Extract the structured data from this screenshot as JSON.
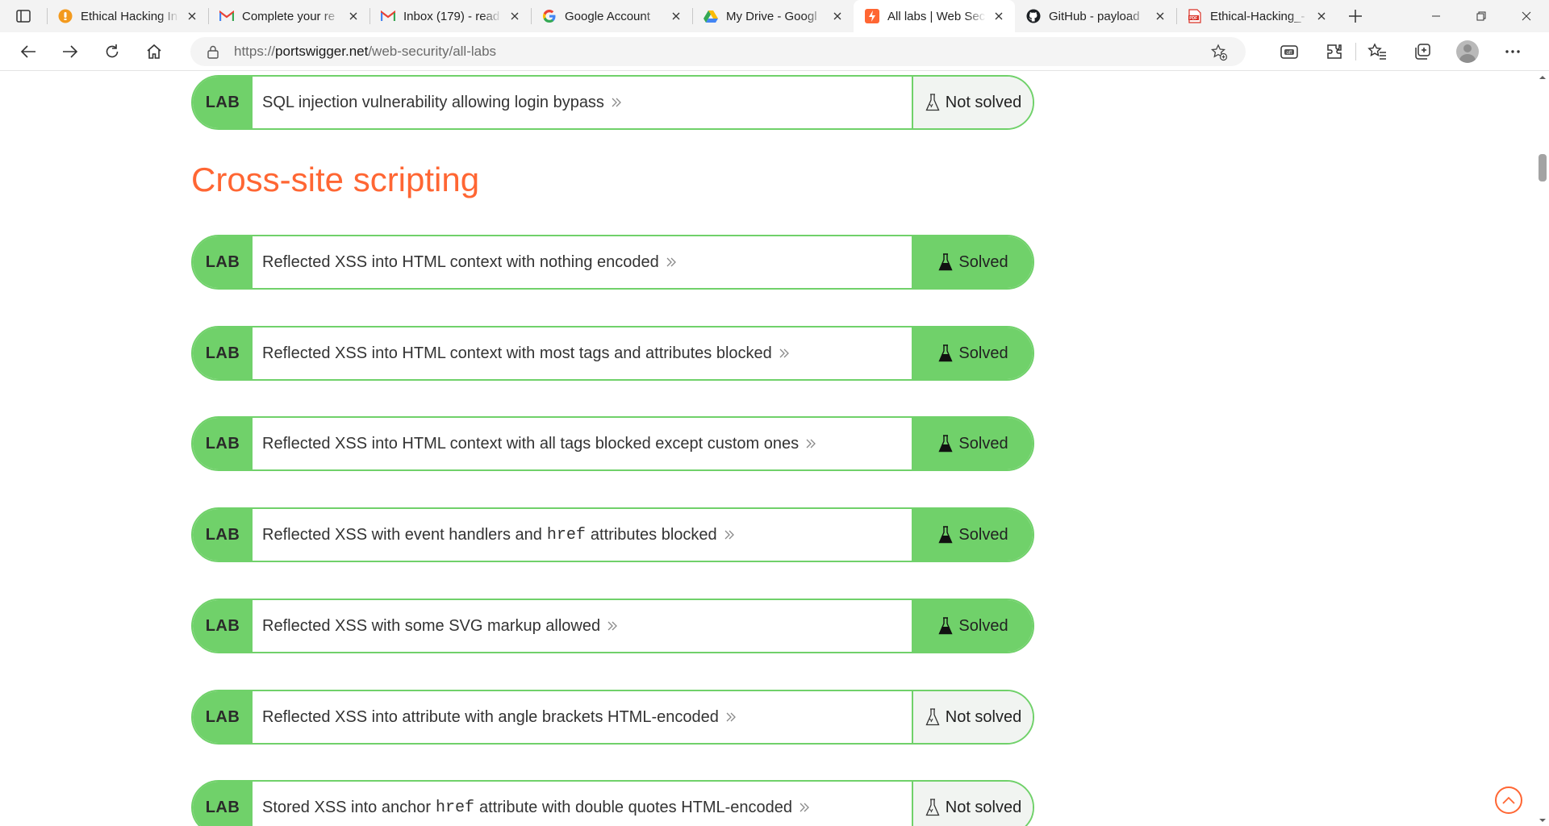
{
  "browser": {
    "tabs": [
      {
        "title": "Ethical Hacking In",
        "favicon": "orange-bulb-icon",
        "active": false
      },
      {
        "title": "Complete your re",
        "favicon": "gmail-icon",
        "active": false
      },
      {
        "title": "Inbox (179) - read",
        "favicon": "gmail-icon",
        "active": false
      },
      {
        "title": "Google Account",
        "favicon": "google-icon",
        "active": false
      },
      {
        "title": "My Drive - Googl",
        "favicon": "google-drive-icon",
        "active": false
      },
      {
        "title": "All labs | Web Sec",
        "favicon": "portswigger-icon",
        "active": true
      },
      {
        "title": "GitHub - payload",
        "favicon": "github-icon",
        "active": false
      },
      {
        "title": "Ethical-Hacking_-",
        "favicon": "pdf-icon",
        "active": false
      }
    ],
    "address": {
      "scheme": "https://",
      "host": "portswigger.net",
      "path": "/web-security/all-labs"
    }
  },
  "page": {
    "section_heading": "Cross-site scripting",
    "labs": [
      {
        "tag": "LAB",
        "title_before": "SQL injection vulnerability allowing login bypass",
        "code": "",
        "title_after": "",
        "status": "Not solved"
      },
      {
        "tag": "LAB",
        "title_before": "Reflected XSS into HTML context with nothing encoded",
        "code": "",
        "title_after": "",
        "status": "Solved"
      },
      {
        "tag": "LAB",
        "title_before": "Reflected XSS into HTML context with most tags and attributes blocked",
        "code": "",
        "title_after": "",
        "status": "Solved"
      },
      {
        "tag": "LAB",
        "title_before": "Reflected XSS into HTML context with all tags blocked except custom ones",
        "code": "",
        "title_after": "",
        "status": "Solved"
      },
      {
        "tag": "LAB",
        "title_before": "Reflected XSS with event handlers and",
        "code": "href",
        "title_after": "attributes blocked",
        "status": "Solved"
      },
      {
        "tag": "LAB",
        "title_before": "Reflected XSS with some SVG markup allowed",
        "code": "",
        "title_after": "",
        "status": "Solved"
      },
      {
        "tag": "LAB",
        "title_before": "Reflected XSS into attribute with angle brackets HTML-encoded",
        "code": "",
        "title_after": "",
        "status": "Not solved"
      },
      {
        "tag": "LAB",
        "title_before": "Stored XSS into anchor",
        "code": "href",
        "title_after": "attribute with double quotes HTML-encoded",
        "status": "Not solved"
      }
    ]
  },
  "colors": {
    "accent_green": "#70d16a",
    "heading_orange": "#ff6633",
    "unsolved_bg": "#f1f4f1"
  }
}
